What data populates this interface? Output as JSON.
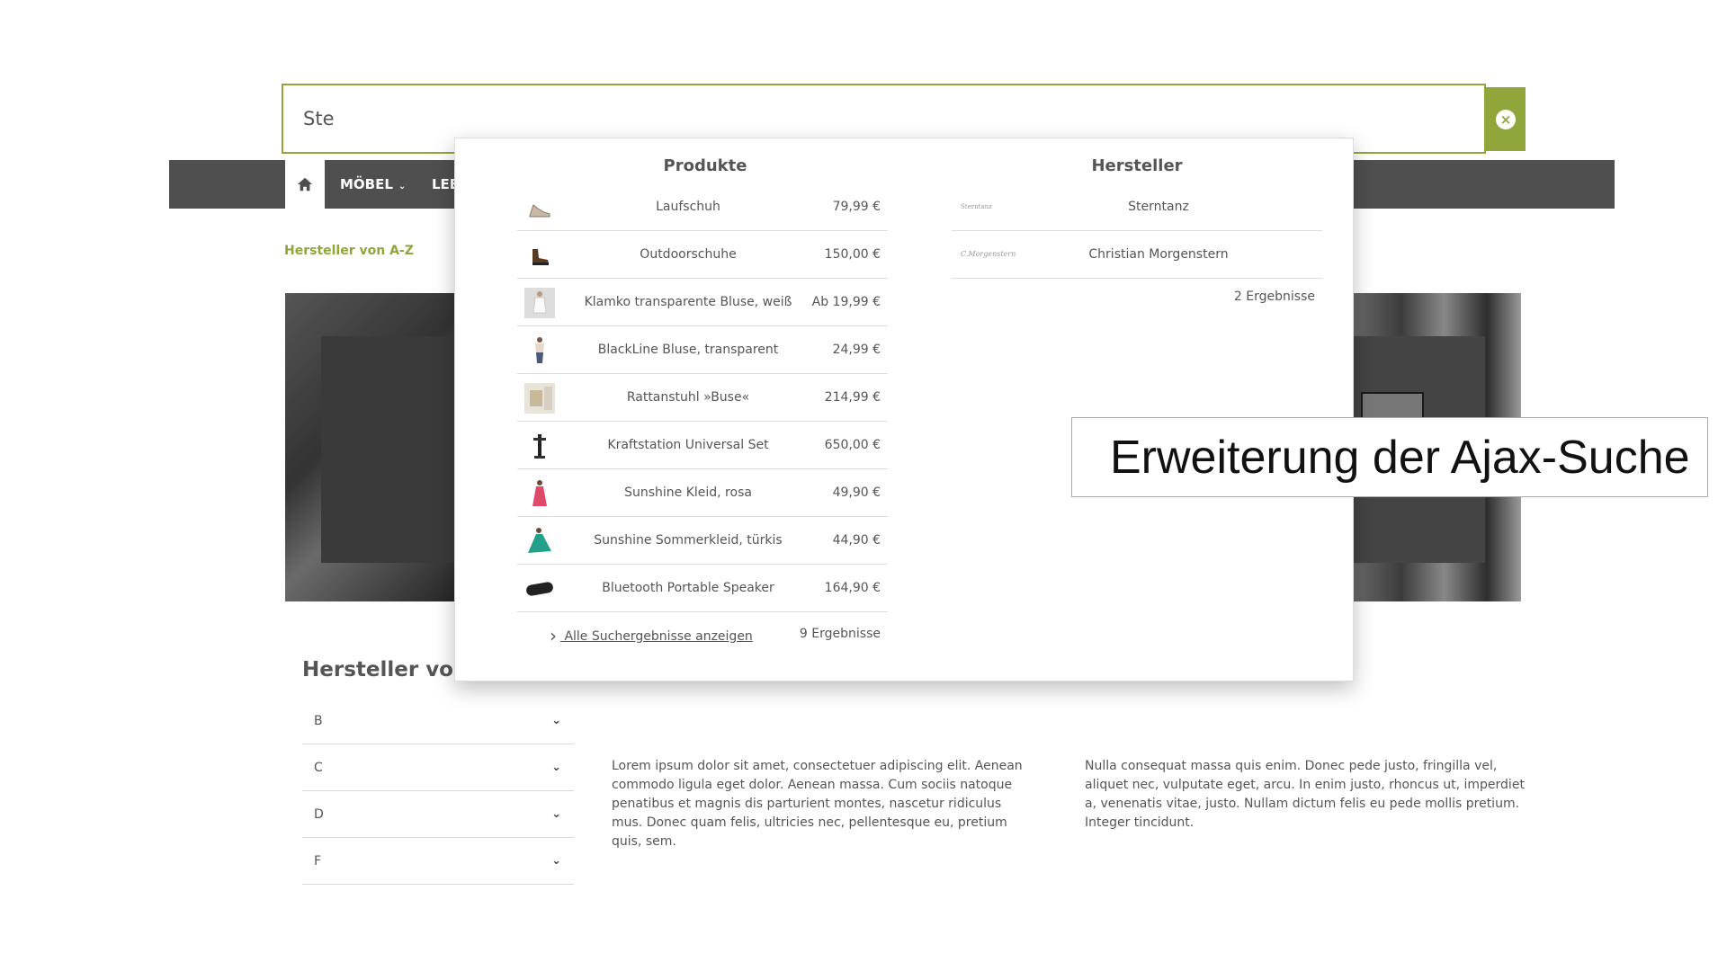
{
  "search": {
    "value": "Ste",
    "clear_icon": "close-circle-icon"
  },
  "nav": {
    "home_icon": "home-icon",
    "items": [
      {
        "label": "MÖBEL",
        "has_caret": true
      },
      {
        "label": "LEE"
      }
    ]
  },
  "breadcrumb": "Hersteller von A-Z",
  "az": {
    "title": "Hersteller von",
    "letters": [
      "B",
      "C",
      "D",
      "F"
    ]
  },
  "lorem": [
    "Lorem ipsum dolor sit amet, consectetuer adipiscing elit. Aenean commodo ligula eget dolor. Aenean massa. Cum sociis natoque penatibus et magnis dis parturient montes, nascetur ridiculus mus. Donec quam felis, ultricies nec, pellentesque eu, pretium quis, sem.",
    "Nulla consequat massa quis enim. Donec pede justo, fringilla vel, aliquet nec, vulputate eget, arcu. In enim justo, rhoncus ut, imperdiet a, venenatis vitae, justo. Nullam dictum felis eu pede mollis pretium. Integer tincidunt."
  ],
  "dropdown": {
    "products_title": "Produkte",
    "manufacturers_title": "Hersteller",
    "products": [
      {
        "name": "Laufschuh",
        "price": "79,99 €",
        "thumb": "shoe"
      },
      {
        "name": "Outdoorschuhe",
        "price": "150,00 €",
        "thumb": "boot"
      },
      {
        "name": "Klamko transparente Bluse, weiß",
        "price": "Ab 19,99 €",
        "thumb": "blouse-white"
      },
      {
        "name": "BlackLine Bluse, transparent",
        "price": "24,99 €",
        "thumb": "blouse-model"
      },
      {
        "name": "Rattanstuhl »Buse«",
        "price": "214,99 €",
        "thumb": "chair"
      },
      {
        "name": "Kraftstation Universal Set",
        "price": "650,00 €",
        "thumb": "gym"
      },
      {
        "name": "Sunshine Kleid, rosa",
        "price": "49,90 €",
        "thumb": "dress-pink"
      },
      {
        "name": "Sunshine Sommerkleid, türkis",
        "price": "44,90 €",
        "thumb": "dress-teal"
      },
      {
        "name": "Bluetooth Portable Speaker",
        "price": "164,90 €",
        "thumb": "speaker"
      }
    ],
    "all_results_label": " Alle Suchergebnisse anzeigen",
    "product_count": "9 Ergebnisse",
    "manufacturers": [
      {
        "name": "Sterntanz",
        "logo": "Sterntanz"
      },
      {
        "name": "Christian Morgenstern",
        "logo": "C.Morgenstern"
      }
    ],
    "manufacturer_count": "2 Ergebnisse"
  },
  "annotation": "Erweiterung der Ajax-Suche",
  "colors": {
    "accent": "#8ea63a",
    "nav_bg": "#4f4f4f",
    "text": "#555555"
  }
}
